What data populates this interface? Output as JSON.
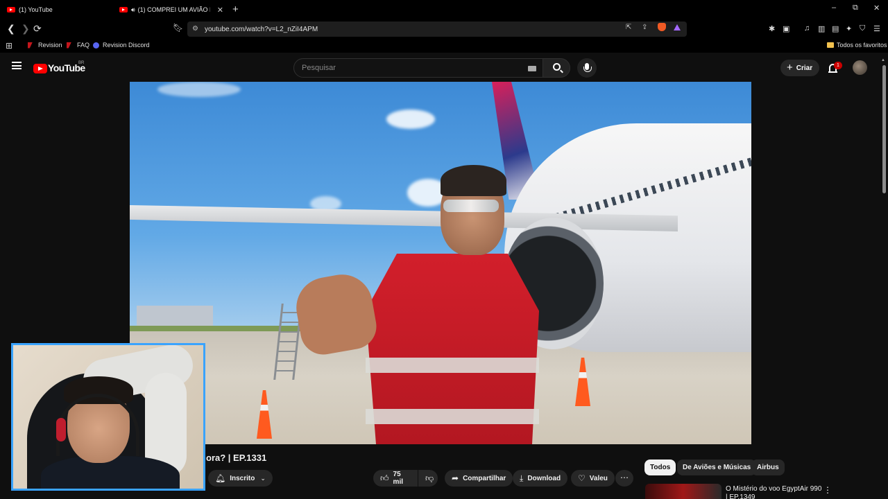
{
  "browser": {
    "tabs": [
      {
        "title": "(1) YouTube"
      },
      {
        "title": "(1) COMPREI UM AVIÃO NOV",
        "audio_icon": "speaker-icon"
      }
    ],
    "new_tab": "+",
    "window": {
      "minimize": "–",
      "restore": "⧉",
      "close": "✕"
    },
    "url": "youtube.com/watch?v=L2_nZiI4APM",
    "bookmarks": [
      {
        "label": "Revision"
      },
      {
        "label": "FAQ"
      },
      {
        "label": "Revision Discord"
      }
    ],
    "all_bookmarks": "Todos os favoritos"
  },
  "youtube": {
    "logo_text": "YouTube",
    "country_code": "BR",
    "search_placeholder": "Pesquisar",
    "create_label": "Criar",
    "notification_count": "1"
  },
  "video": {
    "title_visible": "ora? | EP.1331",
    "subscribe_label": "Inscrito",
    "likes": "75 mil",
    "share_label": "Compartilhar",
    "download_label": "Download",
    "thanks_label": "Valeu",
    "more": "⋯"
  },
  "chips": [
    {
      "label": "Todos",
      "active": true
    },
    {
      "label": "De Aviões e Músicas",
      "active": false
    },
    {
      "label": "Airbus",
      "active": false
    }
  ],
  "recommendation": {
    "title": "O Mistério do voo EgyptAir 990 | EP.1349",
    "menu": "⋮"
  },
  "colors": {
    "background": "#0f0f0f",
    "youtube_red": "#ff0000",
    "webcam_border": "#3aa3ff",
    "pill": "#272727"
  }
}
